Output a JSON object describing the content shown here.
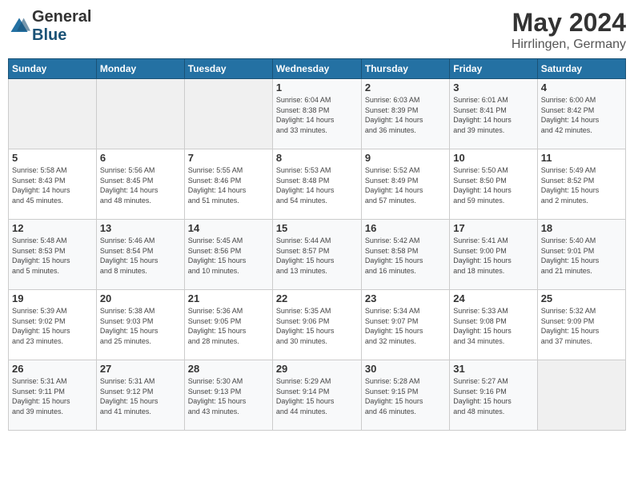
{
  "header": {
    "logo": {
      "general": "General",
      "blue": "Blue"
    },
    "title": "May 2024",
    "location": "Hirrlingen, Germany"
  },
  "weekdays": [
    "Sunday",
    "Monday",
    "Tuesday",
    "Wednesday",
    "Thursday",
    "Friday",
    "Saturday"
  ],
  "weeks": [
    [
      {
        "day": "",
        "info": ""
      },
      {
        "day": "",
        "info": ""
      },
      {
        "day": "",
        "info": ""
      },
      {
        "day": "1",
        "info": "Sunrise: 6:04 AM\nSunset: 8:38 PM\nDaylight: 14 hours\nand 33 minutes."
      },
      {
        "day": "2",
        "info": "Sunrise: 6:03 AM\nSunset: 8:39 PM\nDaylight: 14 hours\nand 36 minutes."
      },
      {
        "day": "3",
        "info": "Sunrise: 6:01 AM\nSunset: 8:41 PM\nDaylight: 14 hours\nand 39 minutes."
      },
      {
        "day": "4",
        "info": "Sunrise: 6:00 AM\nSunset: 8:42 PM\nDaylight: 14 hours\nand 42 minutes."
      }
    ],
    [
      {
        "day": "5",
        "info": "Sunrise: 5:58 AM\nSunset: 8:43 PM\nDaylight: 14 hours\nand 45 minutes."
      },
      {
        "day": "6",
        "info": "Sunrise: 5:56 AM\nSunset: 8:45 PM\nDaylight: 14 hours\nand 48 minutes."
      },
      {
        "day": "7",
        "info": "Sunrise: 5:55 AM\nSunset: 8:46 PM\nDaylight: 14 hours\nand 51 minutes."
      },
      {
        "day": "8",
        "info": "Sunrise: 5:53 AM\nSunset: 8:48 PM\nDaylight: 14 hours\nand 54 minutes."
      },
      {
        "day": "9",
        "info": "Sunrise: 5:52 AM\nSunset: 8:49 PM\nDaylight: 14 hours\nand 57 minutes."
      },
      {
        "day": "10",
        "info": "Sunrise: 5:50 AM\nSunset: 8:50 PM\nDaylight: 14 hours\nand 59 minutes."
      },
      {
        "day": "11",
        "info": "Sunrise: 5:49 AM\nSunset: 8:52 PM\nDaylight: 15 hours\nand 2 minutes."
      }
    ],
    [
      {
        "day": "12",
        "info": "Sunrise: 5:48 AM\nSunset: 8:53 PM\nDaylight: 15 hours\nand 5 minutes."
      },
      {
        "day": "13",
        "info": "Sunrise: 5:46 AM\nSunset: 8:54 PM\nDaylight: 15 hours\nand 8 minutes."
      },
      {
        "day": "14",
        "info": "Sunrise: 5:45 AM\nSunset: 8:56 PM\nDaylight: 15 hours\nand 10 minutes."
      },
      {
        "day": "15",
        "info": "Sunrise: 5:44 AM\nSunset: 8:57 PM\nDaylight: 15 hours\nand 13 minutes."
      },
      {
        "day": "16",
        "info": "Sunrise: 5:42 AM\nSunset: 8:58 PM\nDaylight: 15 hours\nand 16 minutes."
      },
      {
        "day": "17",
        "info": "Sunrise: 5:41 AM\nSunset: 9:00 PM\nDaylight: 15 hours\nand 18 minutes."
      },
      {
        "day": "18",
        "info": "Sunrise: 5:40 AM\nSunset: 9:01 PM\nDaylight: 15 hours\nand 21 minutes."
      }
    ],
    [
      {
        "day": "19",
        "info": "Sunrise: 5:39 AM\nSunset: 9:02 PM\nDaylight: 15 hours\nand 23 minutes."
      },
      {
        "day": "20",
        "info": "Sunrise: 5:38 AM\nSunset: 9:03 PM\nDaylight: 15 hours\nand 25 minutes."
      },
      {
        "day": "21",
        "info": "Sunrise: 5:36 AM\nSunset: 9:05 PM\nDaylight: 15 hours\nand 28 minutes."
      },
      {
        "day": "22",
        "info": "Sunrise: 5:35 AM\nSunset: 9:06 PM\nDaylight: 15 hours\nand 30 minutes."
      },
      {
        "day": "23",
        "info": "Sunrise: 5:34 AM\nSunset: 9:07 PM\nDaylight: 15 hours\nand 32 minutes."
      },
      {
        "day": "24",
        "info": "Sunrise: 5:33 AM\nSunset: 9:08 PM\nDaylight: 15 hours\nand 34 minutes."
      },
      {
        "day": "25",
        "info": "Sunrise: 5:32 AM\nSunset: 9:09 PM\nDaylight: 15 hours\nand 37 minutes."
      }
    ],
    [
      {
        "day": "26",
        "info": "Sunrise: 5:31 AM\nSunset: 9:11 PM\nDaylight: 15 hours\nand 39 minutes."
      },
      {
        "day": "27",
        "info": "Sunrise: 5:31 AM\nSunset: 9:12 PM\nDaylight: 15 hours\nand 41 minutes."
      },
      {
        "day": "28",
        "info": "Sunrise: 5:30 AM\nSunset: 9:13 PM\nDaylight: 15 hours\nand 43 minutes."
      },
      {
        "day": "29",
        "info": "Sunrise: 5:29 AM\nSunset: 9:14 PM\nDaylight: 15 hours\nand 44 minutes."
      },
      {
        "day": "30",
        "info": "Sunrise: 5:28 AM\nSunset: 9:15 PM\nDaylight: 15 hours\nand 46 minutes."
      },
      {
        "day": "31",
        "info": "Sunrise: 5:27 AM\nSunset: 9:16 PM\nDaylight: 15 hours\nand 48 minutes."
      },
      {
        "day": "",
        "info": ""
      }
    ]
  ]
}
